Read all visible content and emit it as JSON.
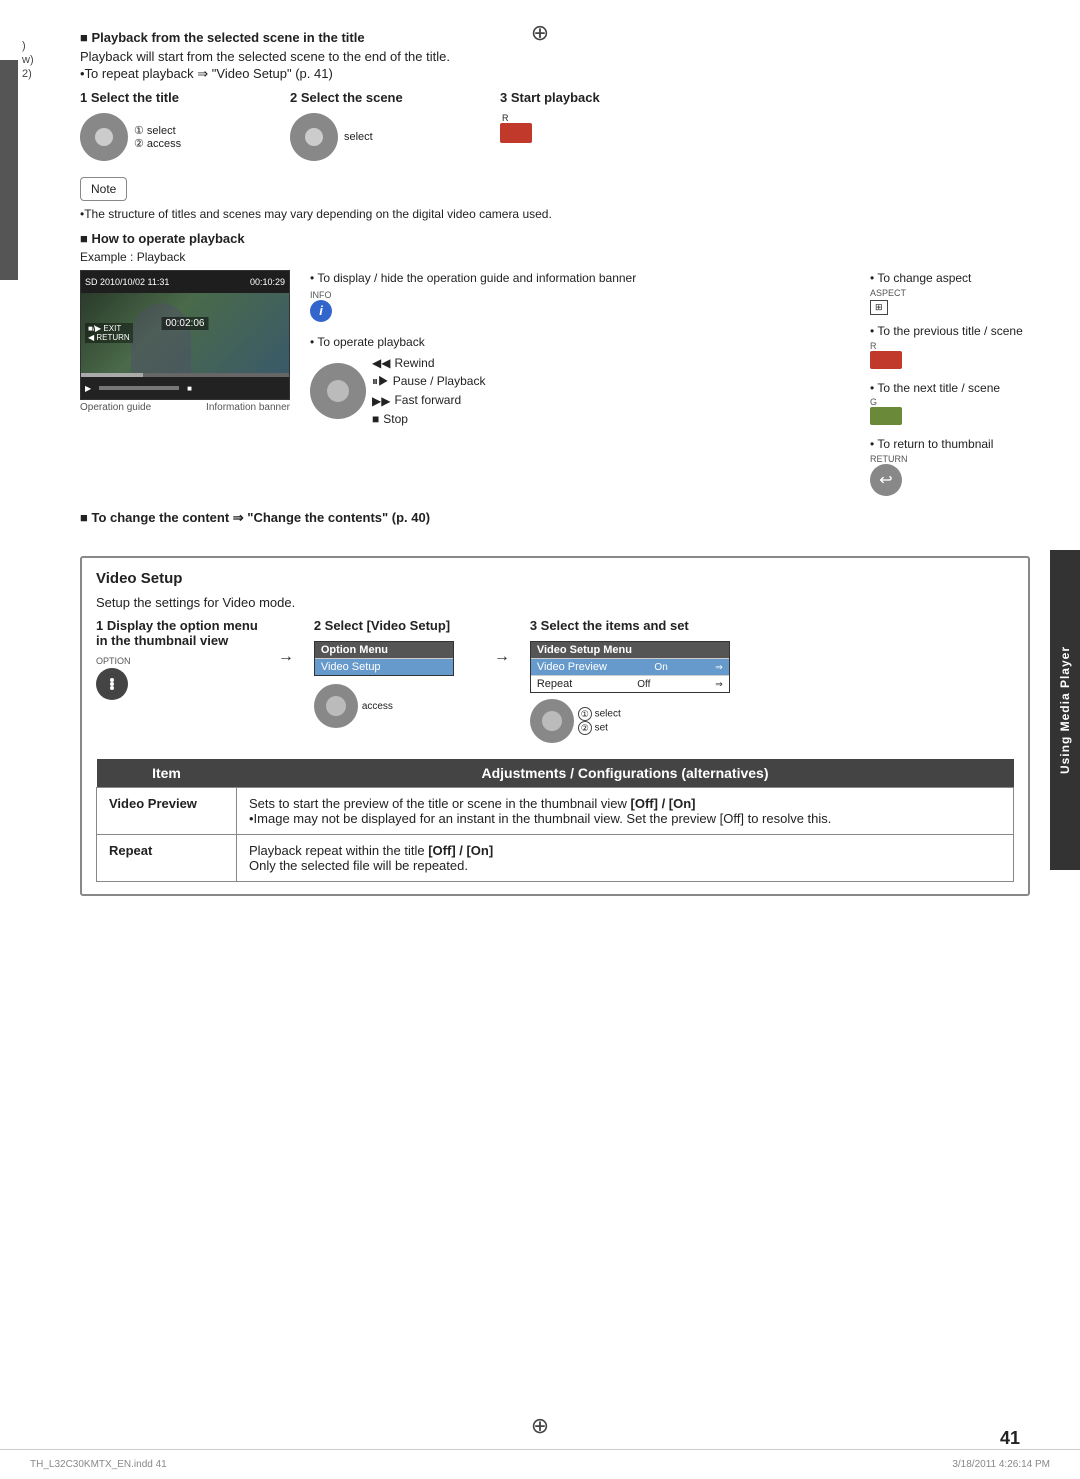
{
  "page": {
    "number": "41",
    "compass_symbol": "⊕",
    "footer_left": "TH_L32C30KMTX_EN.indd   41",
    "footer_right": "3/18/2011   4:26:14 PM"
  },
  "left_marks": [
    ")",
    "w)",
    "2)"
  ],
  "playback_section": {
    "title": "■ Playback from the selected scene in the title",
    "description": "Playback will start from the selected scene to the end of the title.",
    "repeat_note": "•To repeat playback ⇒ \"Video Setup\" (p. 41)",
    "steps": [
      {
        "number": "1",
        "label": "Select the title"
      },
      {
        "number": "2",
        "label": "Select the scene"
      },
      {
        "number": "3",
        "label": "Start playback"
      }
    ],
    "step1_sub": [
      "① select",
      "② access"
    ],
    "step2_sub": [
      "select"
    ],
    "step3_btn": "R",
    "note_text": "Note",
    "note_content": "•The structure of titles and scenes may vary depending on the digital video camera used."
  },
  "how_to_operate": {
    "title": "■ How to operate playback",
    "example_label": "Example : Playback",
    "operation_guide_label": "Operation guide",
    "information_banner_label": "Information banner",
    "screen_info": {
      "top_left": "SD  2010/10/02  11:31",
      "top_right": "00:10:29",
      "time_current": "00:02:06"
    },
    "controls": [
      {
        "label": "•To display / hide the operation guide and information banner",
        "icon": "INFO"
      },
      {
        "label": "•To operate playback",
        "sub": [
          {
            "icon": "rewind",
            "text": "Rewind"
          },
          {
            "icon": "pause",
            "text": "Pause / Playback"
          },
          {
            "icon": "ff",
            "text": "Fast forward"
          },
          {
            "icon": "stop",
            "text": "Stop"
          }
        ]
      }
    ],
    "right_controls": [
      {
        "label": "•To change aspect",
        "sublabel": "ASPECT",
        "icon": "aspect"
      },
      {
        "label": "•To the previous title / scene",
        "sublabel": "R",
        "icon": "btn-red"
      },
      {
        "label": "•To the next title / scene",
        "sublabel": "G",
        "icon": "btn-green"
      },
      {
        "label": "•To return to thumbnail",
        "sublabel": "RETURN",
        "icon": "return"
      }
    ]
  },
  "change_content": {
    "text": "■ To change the content ⇒ \"Change the contents\" (p. 40)"
  },
  "video_setup": {
    "title": "Video Setup",
    "description": "Setup the settings for Video mode.",
    "steps": [
      {
        "number": "1",
        "label": "Display the option menu\nin the thumbnail view",
        "sublabel": "OPTION"
      },
      {
        "number": "2",
        "label": "Select [Video Setup]",
        "menu": {
          "header": "Option Menu",
          "items": [
            "Video Setup"
          ]
        }
      },
      {
        "number": "3",
        "label": "Select the items and set",
        "menu": {
          "header": "Video Setup Menu",
          "items": [
            {
              "name": "Video Preview",
              "value": "On",
              "selected": true
            },
            {
              "name": "Repeat",
              "value": "Off",
              "selected": false
            }
          ]
        },
        "sub": [
          "① select",
          "② set"
        ]
      }
    ],
    "table": {
      "col1_header": "Item",
      "col2_header": "Adjustments / Configurations (alternatives)",
      "rows": [
        {
          "item": "Video Preview",
          "description": "Sets to start the preview of the title or scene in the thumbnail view [Off] / [On]\n•Image may not be displayed for an instant in the thumbnail view. Set the preview [Off] to resolve this."
        },
        {
          "item": "Repeat",
          "description": "Playback repeat within the title [Off] / [On]\nOnly the selected file will be repeated."
        }
      ]
    }
  },
  "sidebar_label": "Using Media Player"
}
